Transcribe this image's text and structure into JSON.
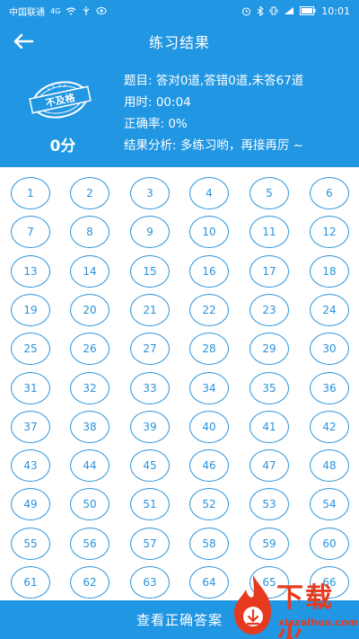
{
  "status_bar": {
    "carrier": "中国联通",
    "signal_text": "4G",
    "time": "10:01"
  },
  "header": {
    "title": "练习结果",
    "back_icon": "arrow-left-icon"
  },
  "summary": {
    "stamp_text": "不及格",
    "score": "0分",
    "questions_line": "题目: 答对0道,答错0道,未答67道",
    "time_line": "用时: 00:04",
    "accuracy_line": "正确率: 0%",
    "analysis_line": "结果分析: 多练习哟，再接再厉 ~"
  },
  "questions": [
    "1",
    "2",
    "3",
    "4",
    "5",
    "6",
    "7",
    "8",
    "9",
    "10",
    "11",
    "12",
    "13",
    "14",
    "15",
    "16",
    "17",
    "18",
    "19",
    "20",
    "21",
    "22",
    "23",
    "24",
    "25",
    "26",
    "27",
    "28",
    "29",
    "30",
    "31",
    "32",
    "33",
    "34",
    "35",
    "36",
    "37",
    "38",
    "39",
    "40",
    "41",
    "42",
    "43",
    "44",
    "45",
    "46",
    "47",
    "48",
    "49",
    "50",
    "51",
    "52",
    "53",
    "54",
    "55",
    "56",
    "57",
    "58",
    "59",
    "60",
    "61",
    "62",
    "63",
    "64",
    "65",
    "66"
  ],
  "bottom": {
    "button_label": "查看正确答案"
  },
  "watermark": {
    "text": "下载火",
    "sub": "xiazaihuo.com"
  },
  "colors": {
    "primary": "#2196e3",
    "circle": "#2a93dc",
    "watermark": "#e63a1f"
  }
}
